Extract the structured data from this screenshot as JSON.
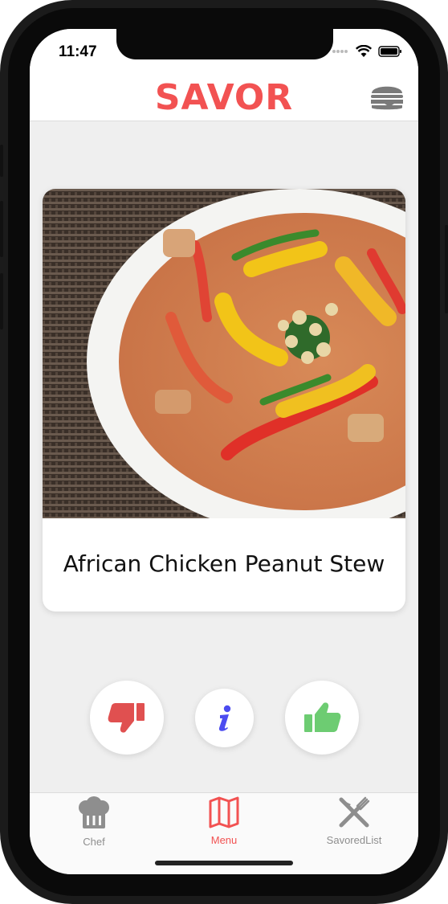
{
  "status_bar": {
    "time": "11:47"
  },
  "header": {
    "title": "SAVOR",
    "menu_icon": "burger-icon"
  },
  "card": {
    "title": "African Chicken Peanut Stew",
    "image_icon": "stew-bowl-photo"
  },
  "actions": [
    {
      "icon": "thumbs-down-icon",
      "color": "#e05050"
    },
    {
      "icon": "info-icon",
      "color": "#4c4cf0"
    },
    {
      "icon": "thumbs-up-icon",
      "color": "#6dcc72"
    }
  ],
  "tabs": [
    {
      "label": "Chef",
      "icon": "chef-hat-icon",
      "color": "#8e8e8e"
    },
    {
      "label": "Menu",
      "icon": "map-icon",
      "color": "#f25252",
      "selected": true
    },
    {
      "label": "SavoredList",
      "icon": "fork-knife-icon",
      "color": "#8e8e8e"
    }
  ],
  "colors": {
    "brand": "#f25252",
    "background": "#efefef"
  }
}
